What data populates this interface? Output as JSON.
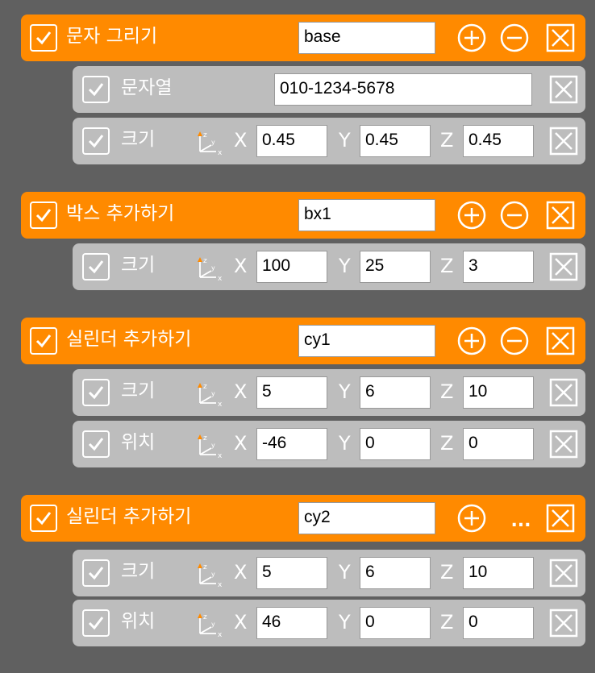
{
  "groups": [
    {
      "title": "문자 그리기",
      "name": "base",
      "third_button": "minus",
      "rows": [
        {
          "type": "text",
          "label": "문자열",
          "value": "010-1234-5678"
        },
        {
          "type": "xyz",
          "label": "크기",
          "x": "0.45",
          "y": "0.45",
          "z": "0.45"
        }
      ]
    },
    {
      "title": "박스 추가하기",
      "name": "bx1",
      "third_button": "minus",
      "rows": [
        {
          "type": "xyz",
          "label": "크기",
          "x": "100",
          "y": "25",
          "z": "3"
        }
      ]
    },
    {
      "title": "실린더 추가하기",
      "name": "cy1",
      "third_button": "minus",
      "rows": [
        {
          "type": "xyz",
          "label": "크기",
          "x": "5",
          "y": "6",
          "z": "10"
        },
        {
          "type": "xyz",
          "label": "위치",
          "x": "-46",
          "y": "0",
          "z": "0"
        }
      ]
    },
    {
      "title": "실린더 추가하기",
      "name": "cy2",
      "third_button": "more",
      "more_label": "...",
      "rows": [
        {
          "type": "xyz",
          "label": "크기",
          "x": "5",
          "y": "6",
          "z": "10"
        },
        {
          "type": "xyz",
          "label": "위치",
          "x": "46",
          "y": "0",
          "z": "0"
        }
      ]
    }
  ],
  "axis_labels": {
    "x": "X",
    "y": "Y",
    "z": "Z"
  },
  "icons": {
    "checkbox": "checkmark-icon",
    "add": "plus-circle-icon",
    "remove": "minus-circle-icon",
    "delete": "close-box-icon",
    "axes": "xyz-axes-icon"
  },
  "colors": {
    "background": "#606060",
    "header": "#ff8a00",
    "row": "#bdbdbd"
  }
}
